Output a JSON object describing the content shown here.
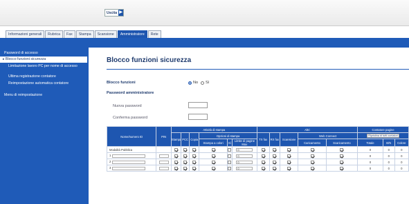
{
  "header": {
    "logout_label": "Uscita"
  },
  "tabs": [
    "Informazioni generali",
    "Rubrica",
    "Fax",
    "Stampa",
    "Scansione",
    "Amministratore",
    "Rete"
  ],
  "active_tab": 5,
  "sidebar": {
    "items": [
      {
        "label": "Password di accesso",
        "active": false,
        "sub": false
      },
      {
        "label": "Blocco funzioni sicurezza",
        "active": true,
        "sub": false
      },
      {
        "label": "Limitazione lavoro PC per nome di accesso",
        "active": false,
        "sub": true
      },
      {
        "label": "Ultima registrazione contatore",
        "active": false,
        "sub": true
      },
      {
        "label": "Reimpostazione automatica contatore",
        "active": false,
        "sub": true
      },
      {
        "label": "Menu di reimpostazione",
        "active": false,
        "sub": false
      }
    ]
  },
  "main": {
    "title": "Blocco funzioni sicurezza",
    "lock_label": "Blocco funzioni",
    "radio_no": "No",
    "radio_si": "Sì",
    "radio_selected": "No",
    "admin_pw_label": "Password amministratore",
    "new_pw_label": "Nuova password",
    "confirm_pw_label": "Conferma password"
  },
  "table": {
    "h_name": "Nome/numero ID",
    "h_pin": "PIN",
    "h_print": "Attività di stampa",
    "h_other": "Altri",
    "h_counter": "Contatore pagine",
    "h_print_opts": "Opzioni di stampa",
    "h_webconnect": "Web Connect",
    "h_reset_all": "Ripristina di tutti contatori",
    "h_stampa": "Stampa",
    "h_pcc": "PCC",
    "h_copia": "Copia",
    "h_stampa_colori": "Stampa a colori",
    "h_limit_pages": "Limite di pagine",
    "h_tx_fax": "TX fax",
    "h_rx_fax": "RX fax",
    "h_scansione": "Scansione",
    "h_caricamento": "Caricamento",
    "h_scaricamento": "Scaricamento",
    "h_si": "Sì",
    "h_max": "Max",
    "h_totale": "Totale",
    "h_bn": "B/N",
    "h_colore": "Colore",
    "rows": [
      {
        "name": "Modalità Pubblica",
        "limit": "0",
        "tot": "0",
        "bn": "0",
        "col": "0"
      },
      {
        "name": "1",
        "limit": "0",
        "tot": "0",
        "bn": "0",
        "col": "0"
      },
      {
        "name": "2",
        "limit": "0",
        "tot": "0",
        "bn": "0",
        "col": "0"
      },
      {
        "name": "3",
        "limit": "0",
        "tot": "0",
        "bn": "0",
        "col": "0"
      }
    ]
  }
}
